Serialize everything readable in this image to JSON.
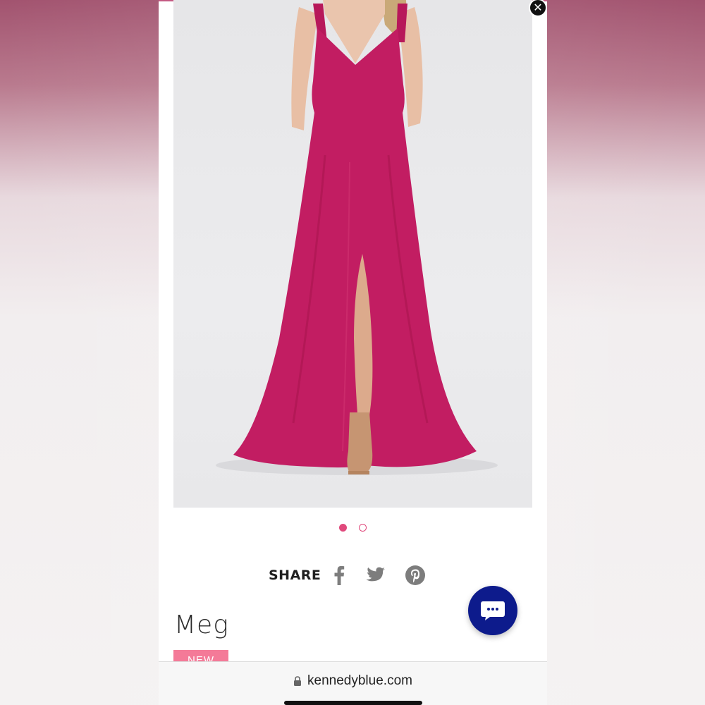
{
  "product": {
    "name": "Meg",
    "badge": "NEW"
  },
  "carousel": {
    "total": 2,
    "active_index": 1
  },
  "share": {
    "label": "SHARE",
    "icons": [
      "facebook-icon",
      "twitter-icon",
      "pinterest-icon"
    ]
  },
  "browser": {
    "url": "kennedyblue.com"
  },
  "colors": {
    "dress": "#c21d62",
    "accent": "#e0497c",
    "badge": "#f47a98",
    "chat": "#0d1b8c"
  }
}
